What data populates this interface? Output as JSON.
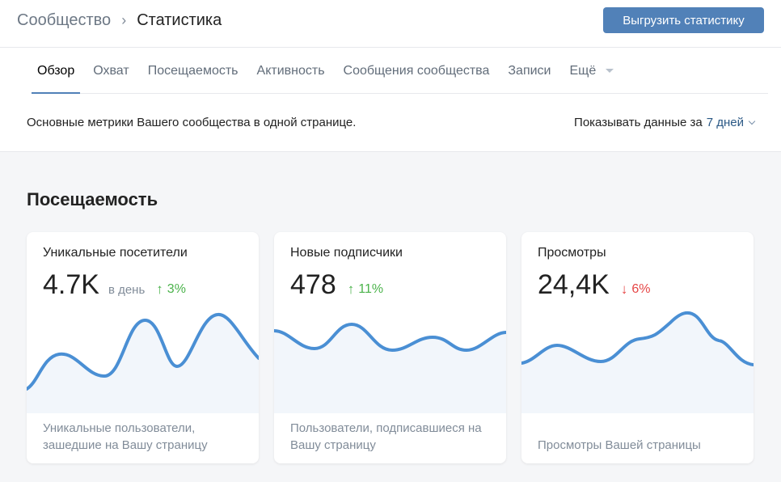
{
  "header": {
    "breadcrumb_parent": "Сообщество",
    "breadcrumb_separator": "›",
    "breadcrumb_current": "Статистика",
    "export_label": "Выгрузить статистику"
  },
  "tabs": [
    {
      "label": "Обзор",
      "active": true
    },
    {
      "label": "Охват"
    },
    {
      "label": "Посещаемость"
    },
    {
      "label": "Активность"
    },
    {
      "label": "Сообщения сообщества"
    },
    {
      "label": "Записи"
    },
    {
      "label": "Ещё"
    }
  ],
  "summary_text": "Основные метрики Вашего сообщества в одной странице.",
  "period": {
    "label": "Показывать данные за",
    "value": "7 дней"
  },
  "section_title": "Посещаемость",
  "colors": {
    "accent": "#5181b8",
    "line": "#4a8fd4",
    "up": "#4bb34b",
    "down": "#e64646"
  },
  "cards": [
    {
      "title": "Уникальные посетители",
      "value": "4.7K",
      "unit": "в день",
      "delta": "3%",
      "delta_direction": "up",
      "arrow": "↑",
      "description": "Уникальные пользователи, зашедшие на Вашу страницу"
    },
    {
      "title": "Новые подписчики",
      "value": "478",
      "delta": "11%",
      "delta_direction": "up",
      "arrow": "↑",
      "description": "Пользователи, подписавшиеся на Вашу страницу"
    },
    {
      "title": "Просмотры",
      "value": "24,4K",
      "delta": "6%",
      "delta_direction": "down",
      "arrow": "↓",
      "description": "Просмотры Вашей страницы"
    }
  ]
}
